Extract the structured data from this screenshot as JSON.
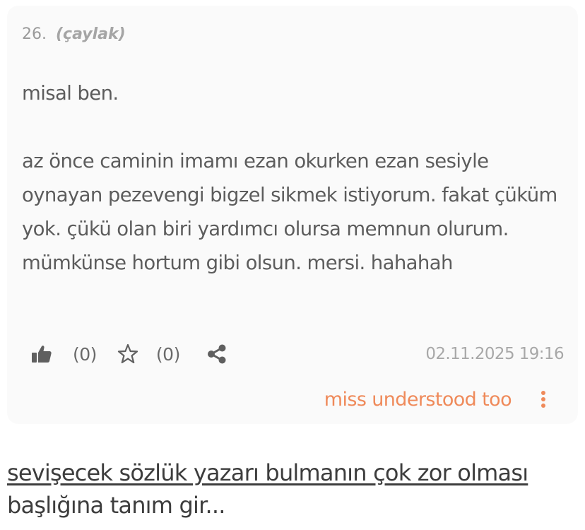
{
  "entry": {
    "number": "26.",
    "status": "(çaylak)",
    "paragraphs": [
      "misal ben.",
      "az önce caminin imamı ezan okurken ezan sesiyle oynayan pezevengi bigzel sikmek istiyorum. fakat çüküm yok. çükü olan biri yardımcı olursa memnun olurum. mümkünse hortum gibi olsun. mersi. hahahah"
    ],
    "likes": {
      "icon": "thumbs-up-icon",
      "count": "(0)"
    },
    "favorites": {
      "icon": "star-outline-icon",
      "count": "(0)"
    },
    "share": {
      "icon": "share-icon"
    },
    "date": "02.11.2025 19:16",
    "author": "miss understood too",
    "menu": {
      "icon": "more-vertical-icon"
    }
  },
  "prompt": {
    "topic": "sevişecek sözlük yazarı bulmanın çok zor olması",
    "suffix": "başlığına tanım gir..."
  },
  "colors": {
    "accent": "#ef8a5a",
    "card_background": "#fafafa",
    "body_text": "#5c5c5c",
    "muted_text": "#a8a8a8"
  }
}
